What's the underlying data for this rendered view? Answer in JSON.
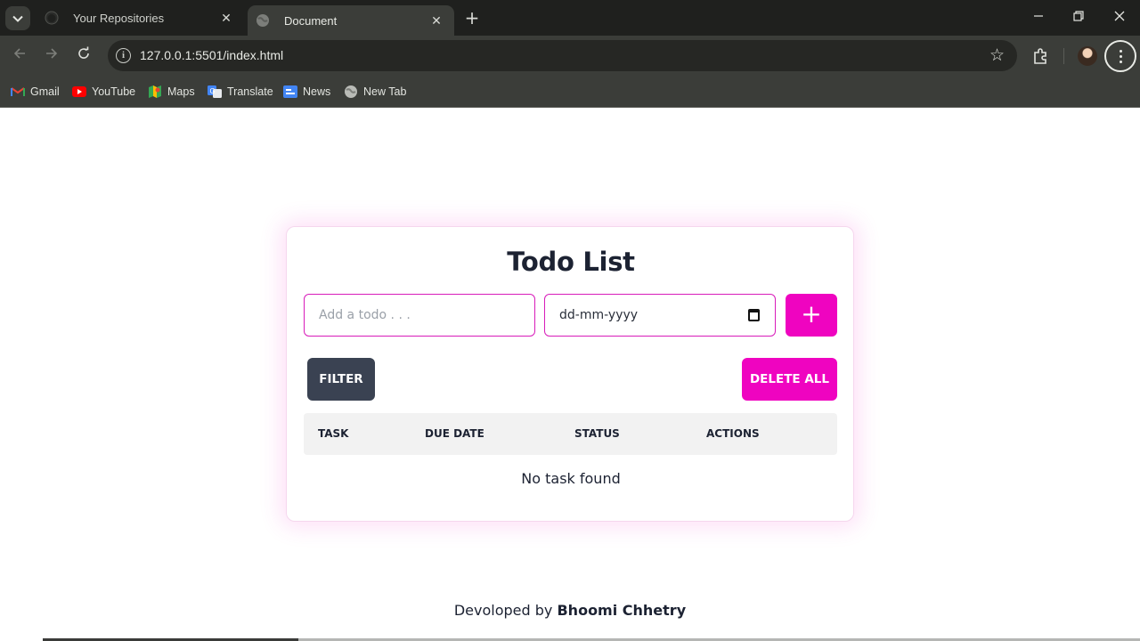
{
  "browser": {
    "tabs": [
      {
        "title": "Your Repositories",
        "favicon": "github-icon",
        "active": false
      },
      {
        "title": "Document",
        "favicon": "globe-icon",
        "active": true
      }
    ],
    "url": "127.0.0.1:5501/index.html",
    "bookmarks": [
      {
        "label": "Gmail",
        "icon": "gmail-icon"
      },
      {
        "label": "YouTube",
        "icon": "youtube-icon"
      },
      {
        "label": "Maps",
        "icon": "maps-icon"
      },
      {
        "label": "Translate",
        "icon": "translate-icon"
      },
      {
        "label": "News",
        "icon": "news-icon"
      },
      {
        "label": "New Tab",
        "icon": "globe-icon"
      }
    ]
  },
  "app": {
    "title": "Todo List",
    "todo_input": {
      "placeholder": "Add a todo . . .",
      "value": ""
    },
    "date_input": {
      "placeholder": "dd-mm-yyyy",
      "value": ""
    },
    "add_label": "+",
    "filter_label": "FILTER",
    "delete_all_label": "DELETE ALL",
    "table": {
      "columns": [
        "TASK",
        "DUE DATE",
        "STATUS",
        "ACTIONS"
      ],
      "rows": [],
      "empty_message": "No task found"
    }
  },
  "footer": {
    "prefix": "Devoloped by",
    "author": "Bhoomi Chhetry"
  },
  "colors": {
    "accent": "#ef04c0",
    "dark_button": "#3a4252",
    "text": "#1c2232"
  }
}
